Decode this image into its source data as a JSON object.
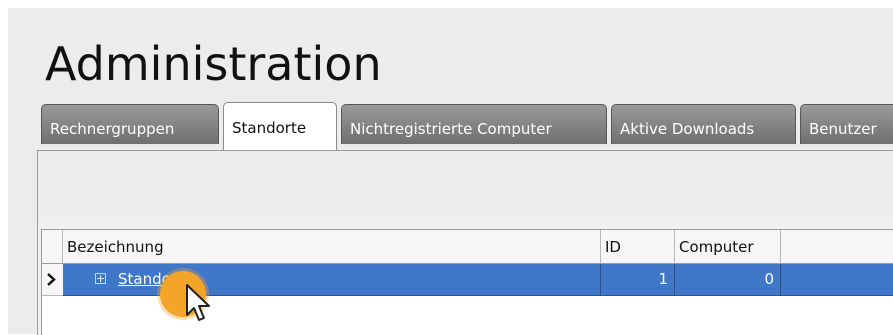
{
  "window": {
    "title": "Administration"
  },
  "tabs": [
    {
      "label": "Rechnergruppen",
      "active": false
    },
    {
      "label": "Standorte",
      "active": true
    },
    {
      "label": "Nichtregistrierte Computer",
      "active": false
    },
    {
      "label": "Aktive Downloads",
      "active": false
    },
    {
      "label": "Benutzer",
      "active": false
    }
  ],
  "grid": {
    "columns": [
      "Bezeichnung",
      "ID",
      "Computer"
    ],
    "rows": [
      {
        "name": "Standort",
        "id": "1",
        "computer": "0",
        "selected": true
      }
    ]
  },
  "colors": {
    "selection": "#3f77c9",
    "tab_bg": "#7f7f7f",
    "highlight": "#f4a428"
  },
  "icons": {
    "row_indicator": "row-pointer-icon",
    "expand": "plus-box-icon",
    "cursor": "mouse-pointer-icon"
  }
}
